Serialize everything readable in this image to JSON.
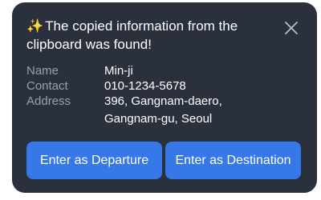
{
  "toast": {
    "headline_line1": "The copied information from the",
    "headline_line2": "clipboard was found!",
    "icon": "sparkle-icon",
    "close_icon": "close-icon",
    "fields": {
      "name_label": "Name",
      "name_value": "Min-ji",
      "contact_label": "Contact",
      "contact_value": "010-1234-5678",
      "address_label": "Address",
      "address_line1": "396, Gangnam-daero,",
      "address_line2": "Gangnam-gu, Seoul"
    },
    "buttons": {
      "departure_label": "Enter as Departure",
      "destination_label": "Enter as Destination"
    }
  },
  "colors": {
    "panel_bg": "#2a313c",
    "accent": "#3778e8",
    "label_gray": "#9aa1ab",
    "sparkle": "#f5c744"
  }
}
